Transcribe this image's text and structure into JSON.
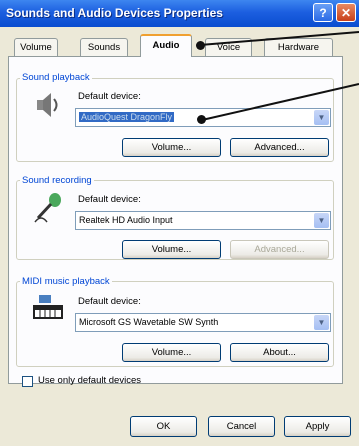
{
  "window": {
    "title": "Sounds and Audio Devices Properties",
    "help_label": "?",
    "close_label": "✕"
  },
  "tabs": [
    {
      "label": "Volume"
    },
    {
      "label": "Sounds"
    },
    {
      "label": "Audio",
      "active": true
    },
    {
      "label": "Voice"
    },
    {
      "label": "Hardware"
    }
  ],
  "playback": {
    "legend": "Sound playback",
    "icon": "speaker-icon",
    "label": "Default device:",
    "device": "AudioQuest DragonFly",
    "volume": "Volume...",
    "advanced": "Advanced..."
  },
  "recording": {
    "legend": "Sound recording",
    "icon": "microphone-icon",
    "label": "Default device:",
    "device": "Realtek HD Audio Input",
    "volume": "Volume...",
    "advanced": "Advanced..."
  },
  "midi": {
    "legend": "MIDI music playback",
    "icon": "midi-keyboard-icon",
    "label": "Default device:",
    "device": "Microsoft GS Wavetable SW Synth",
    "volume": "Volume...",
    "about": "About..."
  },
  "use_only_default": {
    "label": "Use only default devices",
    "checked": false
  },
  "footer": {
    "ok": "OK",
    "cancel": "Cancel",
    "apply": "Apply"
  },
  "colors": {
    "titlebar": "#0a4ccf",
    "accent": "#0046d5",
    "selection": "#316ac5"
  }
}
